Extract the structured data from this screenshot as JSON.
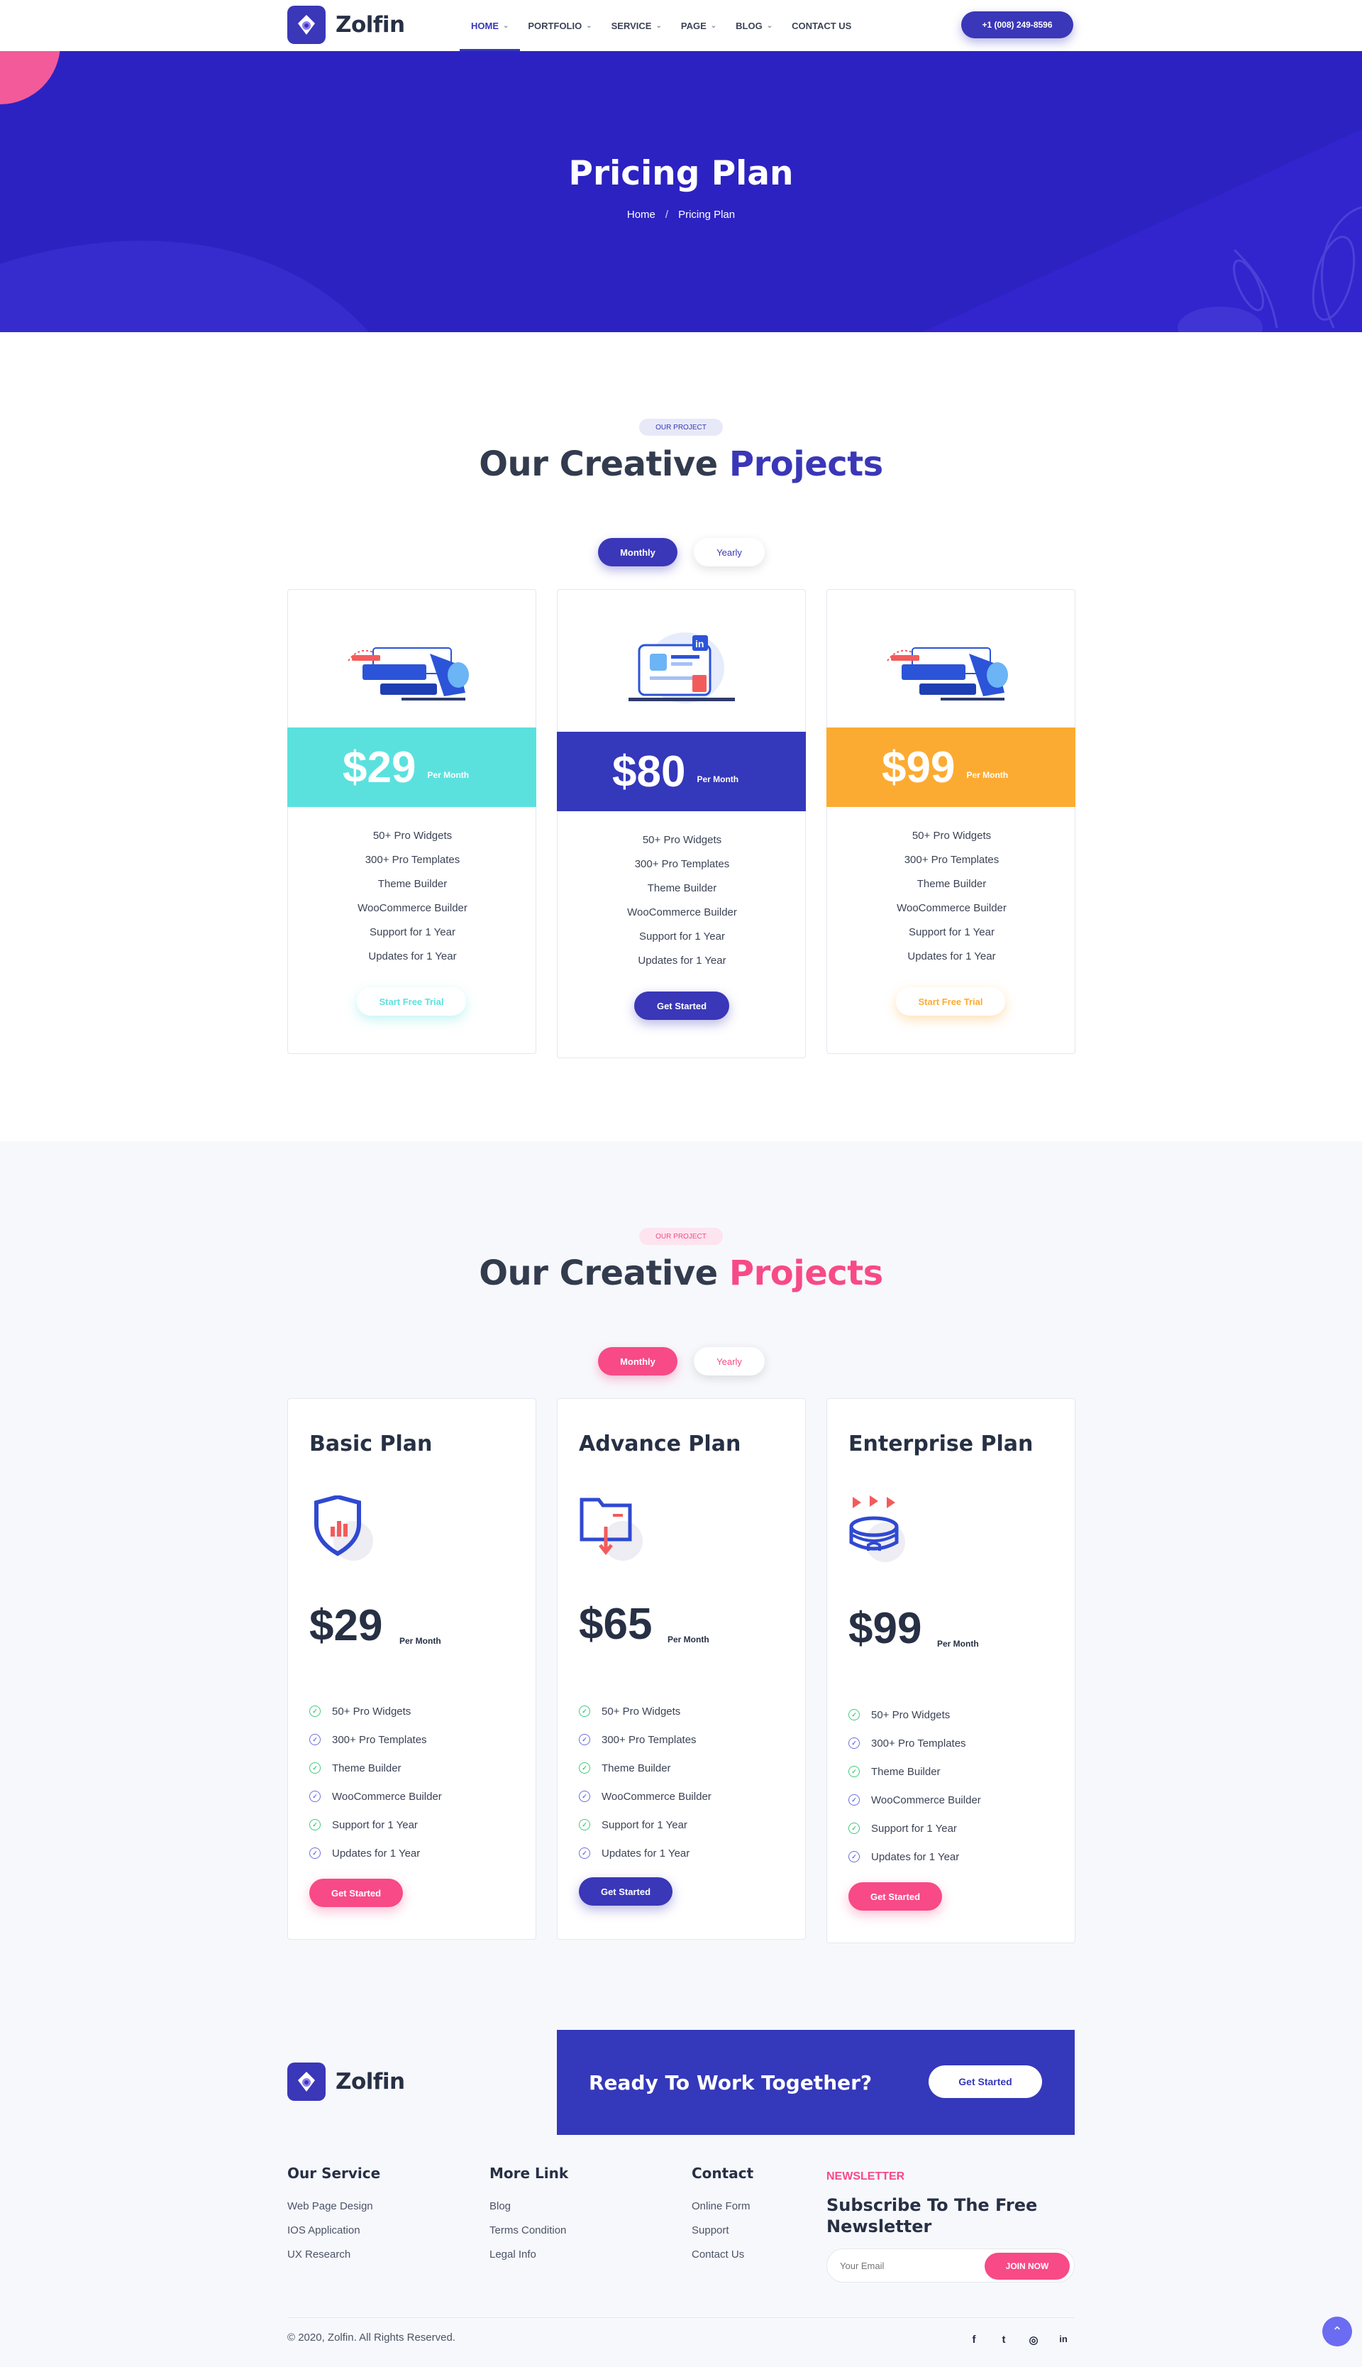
{
  "header": {
    "logo_text": "Zolfin",
    "nav": [
      {
        "label": "HOME",
        "has_dropdown": true,
        "active": true
      },
      {
        "label": "PORTFOLIO",
        "has_dropdown": true
      },
      {
        "label": "SERVICE",
        "has_dropdown": true
      },
      {
        "label": "PAGE",
        "has_dropdown": true
      },
      {
        "label": "BLOG",
        "has_dropdown": true
      },
      {
        "label": "CONTACT US",
        "has_dropdown": false
      }
    ],
    "phone": "+1 (008) 249-8596"
  },
  "hero": {
    "title": "Pricing Plan",
    "breadcrumb": [
      "Home",
      "Pricing Plan"
    ]
  },
  "colors": {
    "primary": "#3a37b8",
    "hero_bg": "#2c22c2",
    "pink": "#f74a86",
    "cyan": "#5ae1de",
    "orange": "#fcab32"
  },
  "section1": {
    "badge": "OUR PROJECT",
    "title_a": "Our Creative",
    "title_b": "Projects",
    "toggle": {
      "active": "Monthly",
      "inactive": "Yearly"
    },
    "cards": [
      {
        "price": "$29",
        "period": "Per Month",
        "features": [
          "50+ Pro Widgets",
          "300+ Pro Templates",
          "Theme Builder",
          "WooCommerce Builder",
          "Support for 1 Year",
          "Updates for 1 Year"
        ],
        "button": "Start Free Trial"
      },
      {
        "price": "$80",
        "period": "Per Month",
        "features": [
          "50+ Pro Widgets",
          "300+ Pro Templates",
          "Theme Builder",
          "WooCommerce Builder",
          "Support for 1 Year",
          "Updates for 1 Year"
        ],
        "button": "Get Started"
      },
      {
        "price": "$99",
        "period": "Per Month",
        "features": [
          "50+ Pro Widgets",
          "300+ Pro Templates",
          "Theme Builder",
          "WooCommerce Builder",
          "Support for 1 Year",
          "Updates for 1 Year"
        ],
        "button": "Start Free Trial"
      }
    ]
  },
  "section2": {
    "badge": "OUR PROJECT",
    "title_a": "Our Creative",
    "title_b": "Projects",
    "toggle": {
      "active": "Monthly",
      "inactive": "Yearly"
    },
    "cards": [
      {
        "name": "Basic Plan",
        "price": "$29",
        "period": "Per Month",
        "icon": "shield-chart-icon",
        "features": [
          "50+ Pro Widgets",
          "300+ Pro Templates",
          "Theme Builder",
          "WooCommerce Builder",
          "Support for 1 Year",
          "Updates for 1 Year"
        ],
        "button": "Get Started"
      },
      {
        "name": "Advance Plan",
        "price": "$65",
        "period": "Per Month",
        "icon": "folder-download-icon",
        "features": [
          "50+ Pro Widgets",
          "300+ Pro Templates",
          "Theme Builder",
          "WooCommerce Builder",
          "Support for 1 Year",
          "Updates for 1 Year"
        ],
        "button": "Get Started"
      },
      {
        "name": "Enterprise Plan",
        "price": "$99",
        "period": "Per Month",
        "icon": "stadium-flags-icon",
        "features": [
          "50+ Pro Widgets",
          "300+ Pro Templates",
          "Theme Builder",
          "WooCommerce Builder",
          "Support for 1 Year",
          "Updates for 1 Year"
        ],
        "button": "Get Started"
      }
    ]
  },
  "footer": {
    "logo_text": "Zolfin",
    "cta_text": "Ready To Work Together?",
    "cta_button": "Get Started",
    "columns": [
      {
        "title": "Our Service",
        "links": [
          "Web Page Design",
          "IOS Application",
          "UX Research"
        ]
      },
      {
        "title": "More Link",
        "links": [
          "Blog",
          "Terms Condition",
          "Legal Info"
        ]
      },
      {
        "title": "Contact",
        "links": [
          "Online Form",
          "Support",
          "Contact Us"
        ]
      }
    ],
    "newsletter": {
      "kicker": "NEWSLETTER",
      "title": "Subscribe To The Free Newsletter",
      "placeholder": "Your Email",
      "button": "JOIN NOW"
    },
    "copyright": "© 2020, Zolfin. All Rights Reserved.",
    "social": [
      {
        "icon": "facebook-icon",
        "glyph": "f"
      },
      {
        "icon": "twitter-icon",
        "glyph": "t"
      },
      {
        "icon": "instagram-icon",
        "glyph": "◎"
      },
      {
        "icon": "linkedin-icon",
        "glyph": "in"
      }
    ]
  }
}
